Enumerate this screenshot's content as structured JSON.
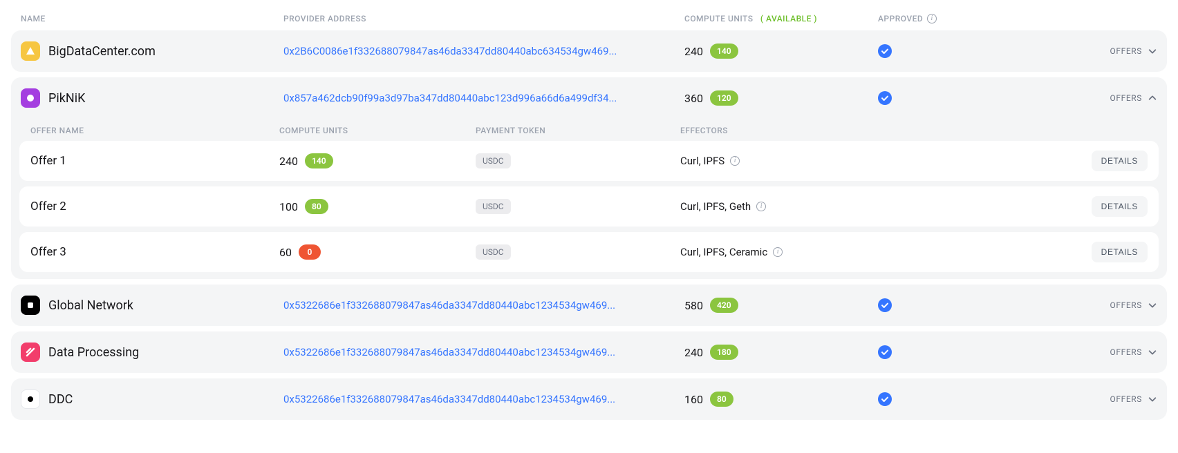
{
  "headers": {
    "name": "NAME",
    "provider_address": "PROVIDER ADDRESS",
    "compute_units": "COMPUTE UNITS",
    "available_tag": "( AVAILABLE )",
    "approved": "APPROVED"
  },
  "offers_headers": {
    "offer_name": "OFFER NAME",
    "compute_units": "COMPUTE UNITS",
    "payment_token": "PAYMENT TOKEN",
    "effectors": "EFFECTORS"
  },
  "labels": {
    "offers": "OFFERS",
    "details": "DETAILS"
  },
  "colors": {
    "link": "#3575ff",
    "pill_green": "#8bc53f",
    "pill_red": "#ef5533"
  },
  "providers": [
    {
      "name": "BigDataCenter.com",
      "logo_color": "#f6c642",
      "address": "0x2B6C0086e1f332688079847as46da3347dd80440abc634534gw469...",
      "cu_total": "240",
      "cu_available": "140",
      "approved": true,
      "expanded": false
    },
    {
      "name": "PikNiK",
      "logo_color": "#a43ee0",
      "address": "0x857a462dcb90f99a3d97ba347dd80440abc123d996a66d6a499df34...",
      "cu_total": "360",
      "cu_available": "120",
      "approved": true,
      "expanded": true,
      "offers": [
        {
          "name": "Offer 1",
          "cu_total": "240",
          "cu_available": "140",
          "pill": "green",
          "token": "USDC",
          "effectors": "Curl, IPFS"
        },
        {
          "name": "Offer 2",
          "cu_total": "100",
          "cu_available": "80",
          "pill": "green",
          "token": "USDC",
          "effectors": "Curl, IPFS, Geth"
        },
        {
          "name": "Offer 3",
          "cu_total": "60",
          "cu_available": "0",
          "pill": "red",
          "token": "USDC",
          "effectors": "Curl, IPFS, Ceramic"
        }
      ]
    },
    {
      "name": "Global Network",
      "logo_color": "#000000",
      "address": "0x5322686e1f332688079847as46da3347dd80440abc1234534gw469...",
      "cu_total": "580",
      "cu_available": "420",
      "approved": true,
      "expanded": false
    },
    {
      "name": "Data Processing",
      "logo_color": "#f23d6b",
      "address": "0x5322686e1f332688079847as46da3347dd80440abc1234534gw469...",
      "cu_total": "240",
      "cu_available": "180",
      "approved": true,
      "expanded": false
    },
    {
      "name": "DDC",
      "logo_color": "#ffffff",
      "address": "0x5322686e1f332688079847as46da3347dd80440abc1234534gw469...",
      "cu_total": "160",
      "cu_available": "80",
      "approved": true,
      "expanded": false
    }
  ]
}
